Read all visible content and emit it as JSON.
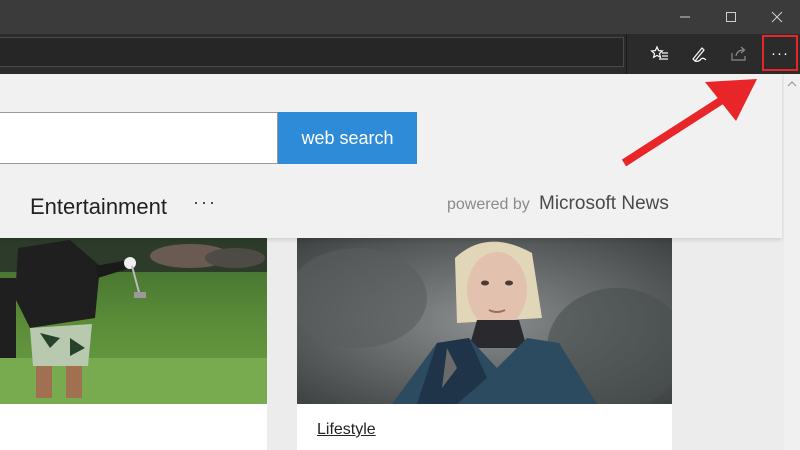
{
  "window": {
    "controls": {
      "minimize_icon": "minimize-icon",
      "maximize_icon": "maximize-icon",
      "close_icon": "close-icon"
    }
  },
  "toolbar": {
    "address_value": "",
    "buttons": [
      "favorites-icon",
      "pen-icon",
      "share-icon"
    ],
    "more_label": "···",
    "highlight_color": "#e8262a"
  },
  "page": {
    "search": {
      "input_value": "",
      "button_label": "web search"
    },
    "category": "Entertainment",
    "category_more": "···",
    "powered_by": "powered by",
    "powered_brand": "Microsoft News",
    "cards": [
      {
        "image": "golfer-photo",
        "tag": ""
      },
      {
        "image": "woman-in-dark-cloak-photo",
        "tag": "Lifestyle"
      }
    ]
  },
  "colors": {
    "accent": "#2e8bd8",
    "arrow": "#e8262a",
    "titlebar": "#3b3b3b",
    "toolbar": "#2b2b2b"
  }
}
